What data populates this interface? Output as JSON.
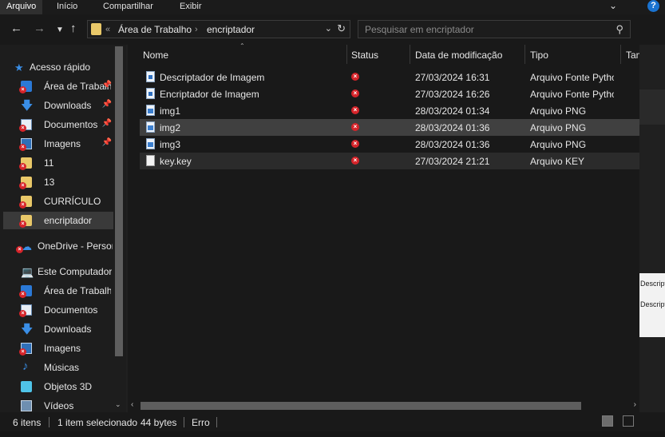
{
  "ribbon": {
    "tabs": [
      "Arquivo",
      "Início",
      "Compartilhar",
      "Exibir"
    ],
    "help_label": "?"
  },
  "address": {
    "sep_prefix": "«",
    "path": [
      "Área de Trabalho",
      "encriptador"
    ]
  },
  "search": {
    "placeholder": "Pesquisar em encriptador"
  },
  "navpane": {
    "quick_access": "Acesso rápido",
    "items": [
      {
        "label": "Área de Trabalho",
        "icon": "desktop-icon",
        "pinned": true
      },
      {
        "label": "Downloads",
        "icon": "download-arrow-icon",
        "pinned": true
      },
      {
        "label": "Documentos",
        "icon": "documents-icon",
        "pinned": true
      },
      {
        "label": "Imagens",
        "icon": "pictures-icon",
        "pinned": true
      },
      {
        "label": "11",
        "icon": "folder-icon",
        "pinned": false
      },
      {
        "label": "13",
        "icon": "folder-icon",
        "pinned": false
      },
      {
        "label": "CURRÍCULO",
        "icon": "folder-icon",
        "pinned": false
      },
      {
        "label": "encriptador",
        "icon": "folder-icon",
        "pinned": false
      }
    ],
    "onedrive": "OneDrive - Personal",
    "this_pc": "Este Computador",
    "pc_items": [
      {
        "label": "Área de Trabalho",
        "icon": "desktop-icon"
      },
      {
        "label": "Documentos",
        "icon": "documents-icon"
      },
      {
        "label": "Downloads",
        "icon": "download-arrow-icon"
      },
      {
        "label": "Imagens",
        "icon": "pictures-icon"
      },
      {
        "label": "Músicas",
        "icon": "music-note-icon"
      },
      {
        "label": "Objetos 3D",
        "icon": "cube-icon"
      },
      {
        "label": "Vídeos",
        "icon": "videos-icon"
      }
    ]
  },
  "filelist": {
    "columns": [
      "Nome",
      "Status",
      "Data de modificação",
      "Tipo",
      "Tam"
    ],
    "rows": [
      {
        "name": "Descriptador de Imagem",
        "date": "27/03/2024 16:31",
        "type": "Arquivo Fonte Python",
        "kind": "py"
      },
      {
        "name": "Encriptador de Imagem",
        "date": "27/03/2024 16:26",
        "type": "Arquivo Fonte Python",
        "kind": "py"
      },
      {
        "name": "img1",
        "date": "28/03/2024 01:34",
        "type": "Arquivo PNG",
        "kind": "png"
      },
      {
        "name": "img2",
        "date": "28/03/2024 01:36",
        "type": "Arquivo PNG",
        "kind": "png"
      },
      {
        "name": "img3",
        "date": "28/03/2024 01:36",
        "type": "Arquivo PNG",
        "kind": "png"
      },
      {
        "name": "key.key",
        "date": "27/03/2024 21:21",
        "type": "Arquivo KEY",
        "kind": "key"
      }
    ]
  },
  "background_popup": {
    "line1": "Descriptador de",
    "line2": "Descriptografa imagem"
  },
  "statusbar": {
    "count": "6 itens",
    "selected": "1 item selecionado",
    "size": "44 bytes",
    "status": "Erro"
  },
  "colors": {
    "background": "#191919",
    "selection": "#404040",
    "error_red": "#d6242a",
    "folder_yellow": "#e9c869",
    "accent_blue": "#1a73d0"
  }
}
